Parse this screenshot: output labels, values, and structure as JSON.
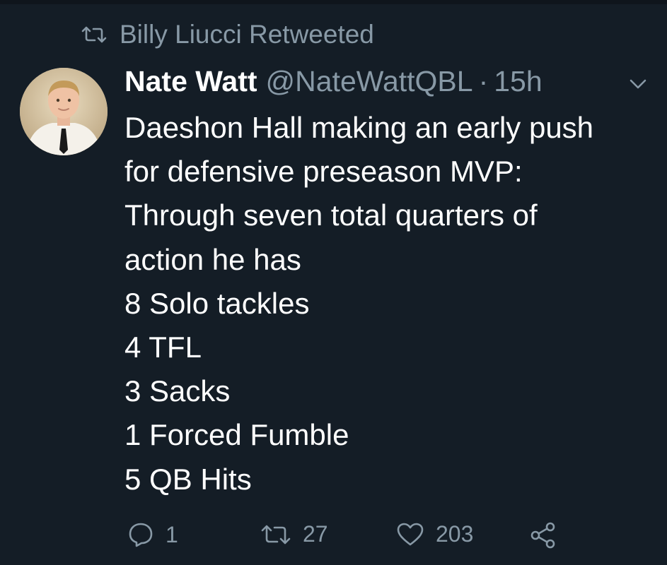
{
  "retweet_context": {
    "text": "Billy Liucci Retweeted",
    "icon": "retweet-icon"
  },
  "tweet": {
    "author_name": "Nate Watt",
    "author_handle": "@NateWattQBL",
    "separator": "·",
    "timestamp": "15h",
    "avatar": "avatar",
    "menu_icon": "chevron-down-icon",
    "lines": [
      "Daeshon Hall making an early push",
      "for defensive preseason MVP:",
      "Through seven total quarters of",
      "action he has",
      "8 Solo tackles",
      "4 TFL",
      "3 Sacks",
      "1 Forced Fumble",
      "5 QB Hits"
    ]
  },
  "actions": {
    "reply": {
      "icon": "reply-icon",
      "count": "1"
    },
    "retweet": {
      "icon": "retweet-icon",
      "count": "27"
    },
    "like": {
      "icon": "heart-icon",
      "count": "203"
    },
    "share": {
      "icon": "share-icon"
    }
  },
  "colors": {
    "background": "#141d26",
    "primary_text": "#ffffff",
    "secondary_text": "#8899a6"
  }
}
